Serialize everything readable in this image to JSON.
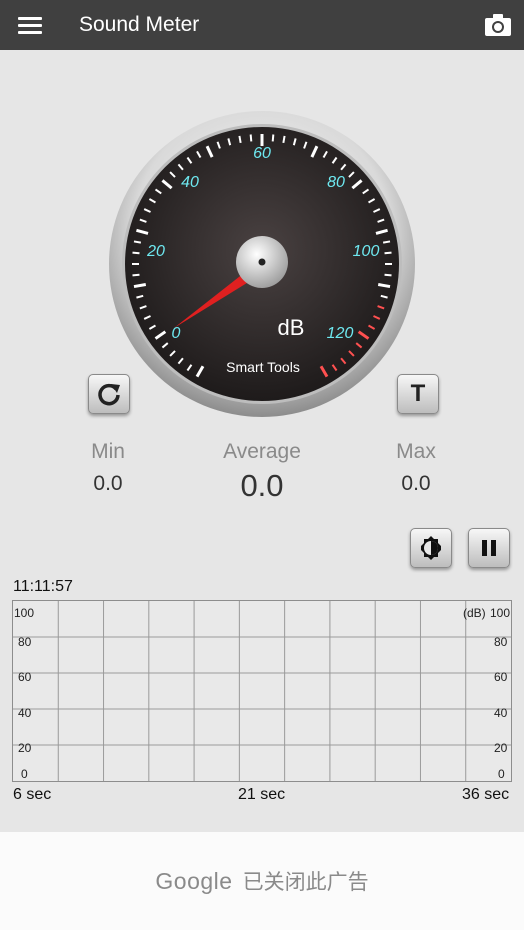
{
  "app": {
    "title": "Sound Meter"
  },
  "gauge": {
    "scale_labels": [
      "0",
      "20",
      "40",
      "60",
      "80",
      "100",
      "120"
    ],
    "unit": "dB",
    "brand": "Smart Tools",
    "value": 0
  },
  "stats": {
    "min_label": "Min",
    "min_value": "0.0",
    "avg_label": "Average",
    "avg_value": "0.0",
    "max_label": "Max",
    "max_value": "0.0"
  },
  "graph": {
    "time": "11:11:57",
    "unit": "(dB)",
    "y_ticks": [
      "100",
      "80",
      "60",
      "40",
      "20",
      "0"
    ],
    "x_labels": [
      "6 sec",
      "21 sec",
      "36 sec"
    ]
  },
  "controls": {
    "t_label": "T"
  },
  "ad": {
    "brand": "Google",
    "text": "已关闭此广告"
  },
  "colors": {
    "topbar": "#404040",
    "scale": "#6ee8f0",
    "needle": "#e02020"
  },
  "icons": [
    "menu-icon",
    "camera-icon",
    "refresh-icon",
    "brightness-icon",
    "pause-icon"
  ]
}
